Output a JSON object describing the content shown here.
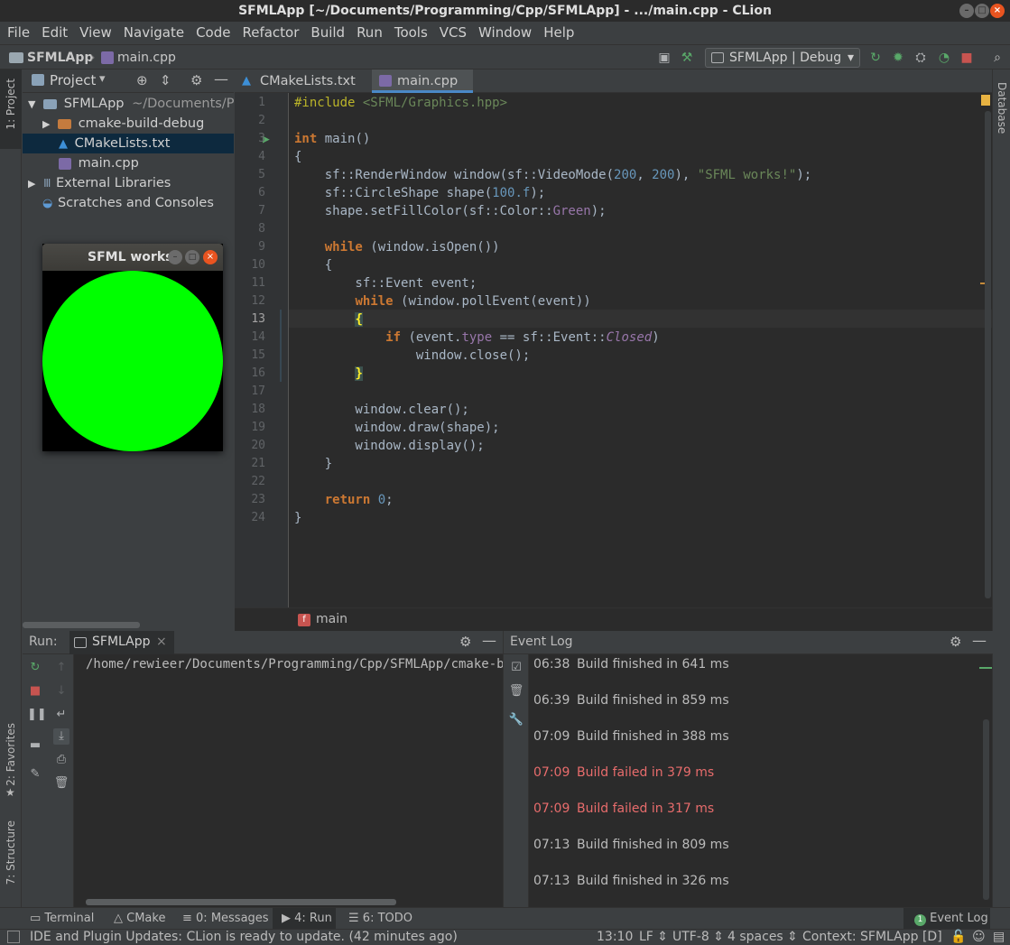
{
  "window": {
    "title": "SFMLApp [~/Documents/Programming/Cpp/SFMLApp] - .../main.cpp - CLion"
  },
  "menu": [
    "File",
    "Edit",
    "View",
    "Navigate",
    "Code",
    "Refactor",
    "Build",
    "Run",
    "Tools",
    "VCS",
    "Window",
    "Help"
  ],
  "navbar": {
    "project": "SFMLApp",
    "file": "main.cpp",
    "run_config": "SFMLApp | Debug"
  },
  "side_tabs": {
    "project": "1: Project",
    "favorites": "2: Favorites",
    "structure": "7: Structure",
    "database": "Database"
  },
  "project_panel": {
    "title": "Project",
    "tree": [
      {
        "label": "SFMLApp",
        "path": "~/Documents/Pro"
      },
      {
        "label": "cmake-build-debug"
      },
      {
        "label": "CMakeLists.txt"
      },
      {
        "label": "main.cpp"
      },
      {
        "label": "External Libraries"
      },
      {
        "label": "Scratches and Consoles"
      }
    ]
  },
  "sfml_window": {
    "title": "SFML works!",
    "fill_color": "#00ff00"
  },
  "editor": {
    "tabs": [
      "CMakeLists.txt",
      "main.cpp"
    ],
    "current_line": 13,
    "breadcrumb": "main",
    "lines": [
      "#include <SFML/Graphics.hpp>",
      "",
      "int main()",
      "{",
      "    sf::RenderWindow window(sf::VideoMode(200, 200), \"SFML works!\");",
      "    sf::CircleShape shape(100.f);",
      "    shape.setFillColor(sf::Color::Green);",
      "",
      "    while (window.isOpen())",
      "    {",
      "        sf::Event event;",
      "        while (window.pollEvent(event))",
      "        {",
      "            if (event.type == sf::Event::Closed)",
      "                window.close();",
      "        }",
      "",
      "        window.clear();",
      "        window.draw(shape);",
      "        window.display();",
      "    }",
      "",
      "    return 0;",
      "}"
    ]
  },
  "run_panel": {
    "label": "Run:",
    "config": "SFMLApp",
    "output": "/home/rewieer/Documents/Programming/Cpp/SFMLApp/cmake-buil"
  },
  "event_log": {
    "title": "Event Log",
    "entries": [
      {
        "time": "06:38",
        "msg": "Build finished in 641 ms",
        "status": "ok"
      },
      {
        "time": "06:39",
        "msg": "Build finished in 859 ms",
        "status": "ok"
      },
      {
        "time": "07:09",
        "msg": "Build finished in 388 ms",
        "status": "ok"
      },
      {
        "time": "07:09",
        "msg": "Build failed in 379 ms",
        "status": "error"
      },
      {
        "time": "07:09",
        "msg": "Build failed in 317 ms",
        "status": "error"
      },
      {
        "time": "07:13",
        "msg": "Build finished in 809 ms",
        "status": "ok"
      },
      {
        "time": "07:13",
        "msg": "Build finished in 326 ms",
        "status": "ok"
      }
    ]
  },
  "tool_tabs": {
    "terminal": "Terminal",
    "cmake": "CMake",
    "messages": "0: Messages",
    "run": "4: Run",
    "todo": "6: TODO",
    "event_log_count": "1",
    "event_log": "Event Log"
  },
  "status": {
    "message": "IDE and Plugin Updates: CLion is ready to update. (42 minutes ago)",
    "position": "13:10",
    "line_sep": "LF",
    "encoding": "UTF-8",
    "indent": "4 spaces",
    "context": "Context: SFMLApp [D]"
  },
  "colors": {
    "accent": "#4a88c7",
    "run_green": "#59a869",
    "error": "#e86c6c"
  }
}
